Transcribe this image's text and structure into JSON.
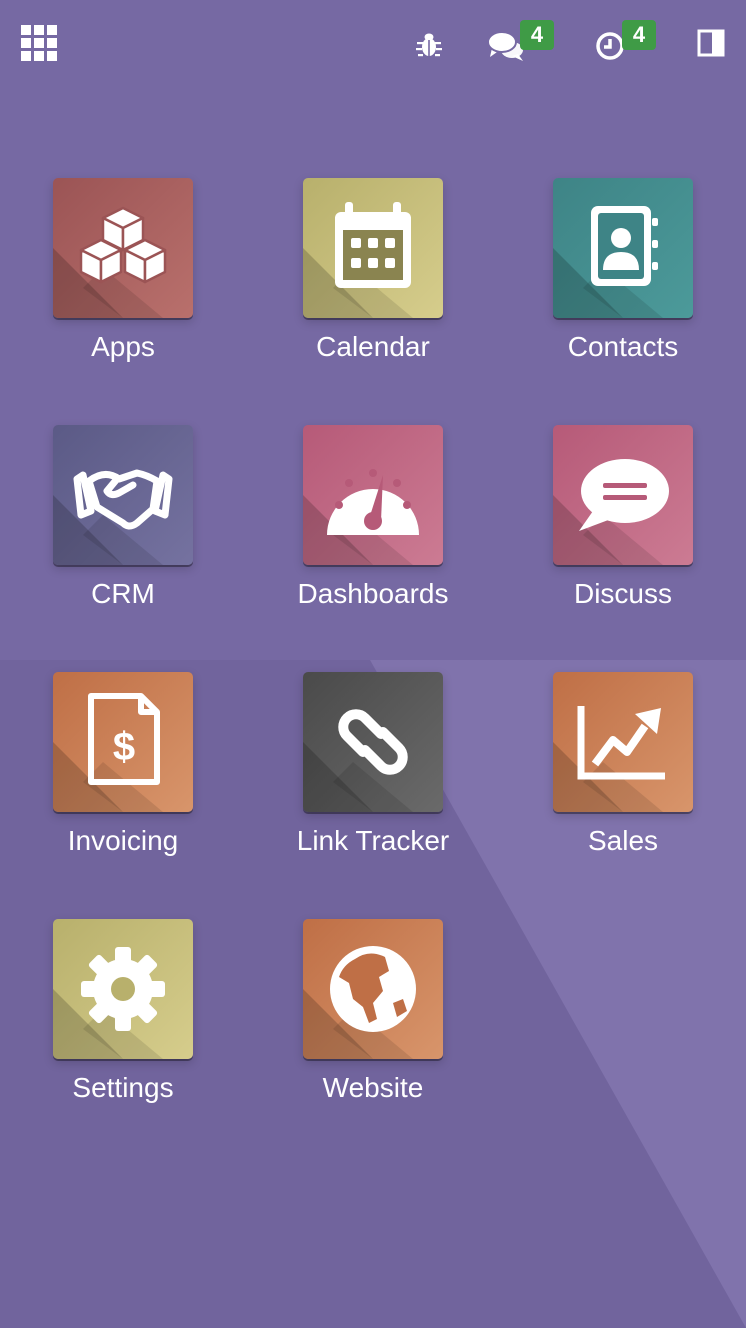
{
  "colors": {
    "background": "#7a6ca6",
    "badge": "#3f9b46",
    "label": "#ffffff"
  },
  "topbar": {
    "menu_icon": "grid-icon",
    "debug_icon": "bug-icon",
    "messages": {
      "icon": "chat-icon",
      "badge": "4"
    },
    "activities": {
      "icon": "clock-icon",
      "badge": "4"
    },
    "panel_icon": "sidebar-toggle-icon"
  },
  "apps": [
    {
      "key": "apps",
      "label": "Apps",
      "icon": "cubes-icon",
      "color": "#9b5455",
      "color2": "#b9706c"
    },
    {
      "key": "calendar",
      "label": "Calendar",
      "icon": "calendar-icon",
      "color": "#b8b06c",
      "color2": "#d6cd8c"
    },
    {
      "key": "contacts",
      "label": "Contacts",
      "icon": "contact-book-icon",
      "color": "#3e8486",
      "color2": "#4c9a9a"
    },
    {
      "key": "crm",
      "label": "CRM",
      "icon": "handshake-icon",
      "color": "#5b5a86",
      "color2": "#7572a0"
    },
    {
      "key": "dashboards",
      "label": "Dashboards",
      "icon": "gauge-icon",
      "color": "#b65a78",
      "color2": "#cc7b93"
    },
    {
      "key": "discuss",
      "label": "Discuss",
      "icon": "speech-bubble-icon",
      "color": "#b65a78",
      "color2": "#cc7b93"
    },
    {
      "key": "invoicing",
      "label": "Invoicing",
      "icon": "invoice-dollar-icon",
      "color": "#bf6f46",
      "color2": "#d8956b"
    },
    {
      "key": "link_tracker",
      "label": "Link Tracker",
      "icon": "chain-link-icon",
      "color": "#4a4a4a",
      "color2": "#6a6a6a"
    },
    {
      "key": "sales",
      "label": "Sales",
      "icon": "trend-chart-icon",
      "color": "#bf6f46",
      "color2": "#d8956b"
    },
    {
      "key": "settings",
      "label": "Settings",
      "icon": "gear-icon",
      "color": "#b8b06c",
      "color2": "#d6cd8c"
    },
    {
      "key": "website",
      "label": "Website",
      "icon": "globe-icon",
      "color": "#bf6f46",
      "color2": "#d8956b"
    }
  ]
}
